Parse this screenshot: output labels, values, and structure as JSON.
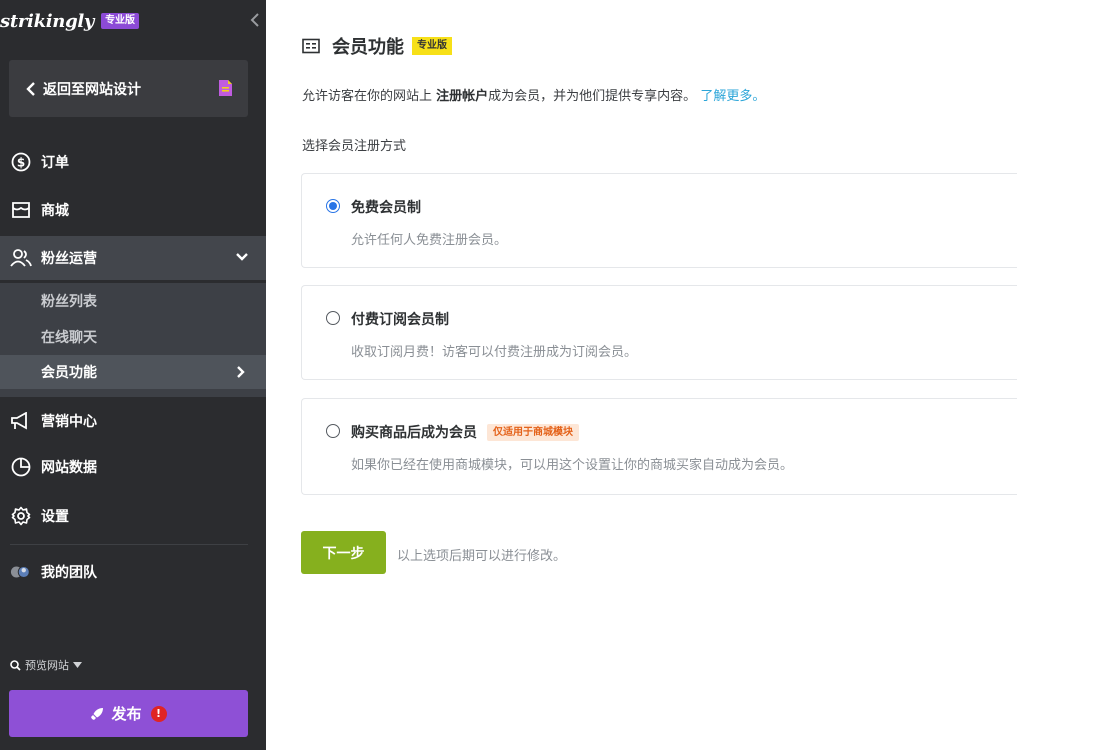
{
  "brand": {
    "logo": "strikingly",
    "pro_badge": "专业版"
  },
  "sidebar": {
    "back_label": "返回至网站设计",
    "items": [
      {
        "label": "订单",
        "icon": "dollar-circle-icon"
      },
      {
        "label": "商城",
        "icon": "store-icon"
      },
      {
        "label": "粉丝运营",
        "icon": "fans-icon",
        "expanded": true
      },
      {
        "label": "营销中心",
        "icon": "megaphone-icon"
      },
      {
        "label": "网站数据",
        "icon": "pie-chart-icon"
      },
      {
        "label": "设置",
        "icon": "gear-icon"
      },
      {
        "label": "我的团队",
        "icon": "team-avatars-icon"
      }
    ],
    "subitems": [
      {
        "label": "粉丝列表"
      },
      {
        "label": "在线聊天"
      },
      {
        "label": "会员功能",
        "active": true
      }
    ],
    "preview_label": "预览网站",
    "publish_label": "发布",
    "publish_alert": "!"
  },
  "main": {
    "title": "会员功能",
    "pro_badge": "专业版",
    "desc_prefix": "允许访客在你的网站上 ",
    "desc_bold": "注册帐户",
    "desc_suffix": "成为会员，并为他们提供专享内容。",
    "desc_link": "了解更多。",
    "section_label": "选择会员注册方式",
    "options": [
      {
        "title": "免费会员制",
        "desc": "允许任何人免费注册会员。",
        "checked": true,
        "badge": ""
      },
      {
        "title": "付费订阅会员制",
        "desc": "收取订阅月费！访客可以付费注册成为订阅会员。",
        "checked": false,
        "badge": ""
      },
      {
        "title": "购买商品后成为会员",
        "desc": "如果你已经在使用商城模块，可以用这个设置让你的商城买家自动成为会员。",
        "checked": false,
        "badge": "仅适用于商城模块"
      }
    ],
    "next_label": "下一步",
    "next_hint": "以上选项后期可以进行修改。"
  },
  "colors": {
    "sidebar_bg": "#2b2c2f",
    "publish": "#8e50d6",
    "next": "#86b01e",
    "link": "#2ba5d8",
    "radio_checked": "#2874e6",
    "pro_badge_yellow": "#f7e018"
  }
}
